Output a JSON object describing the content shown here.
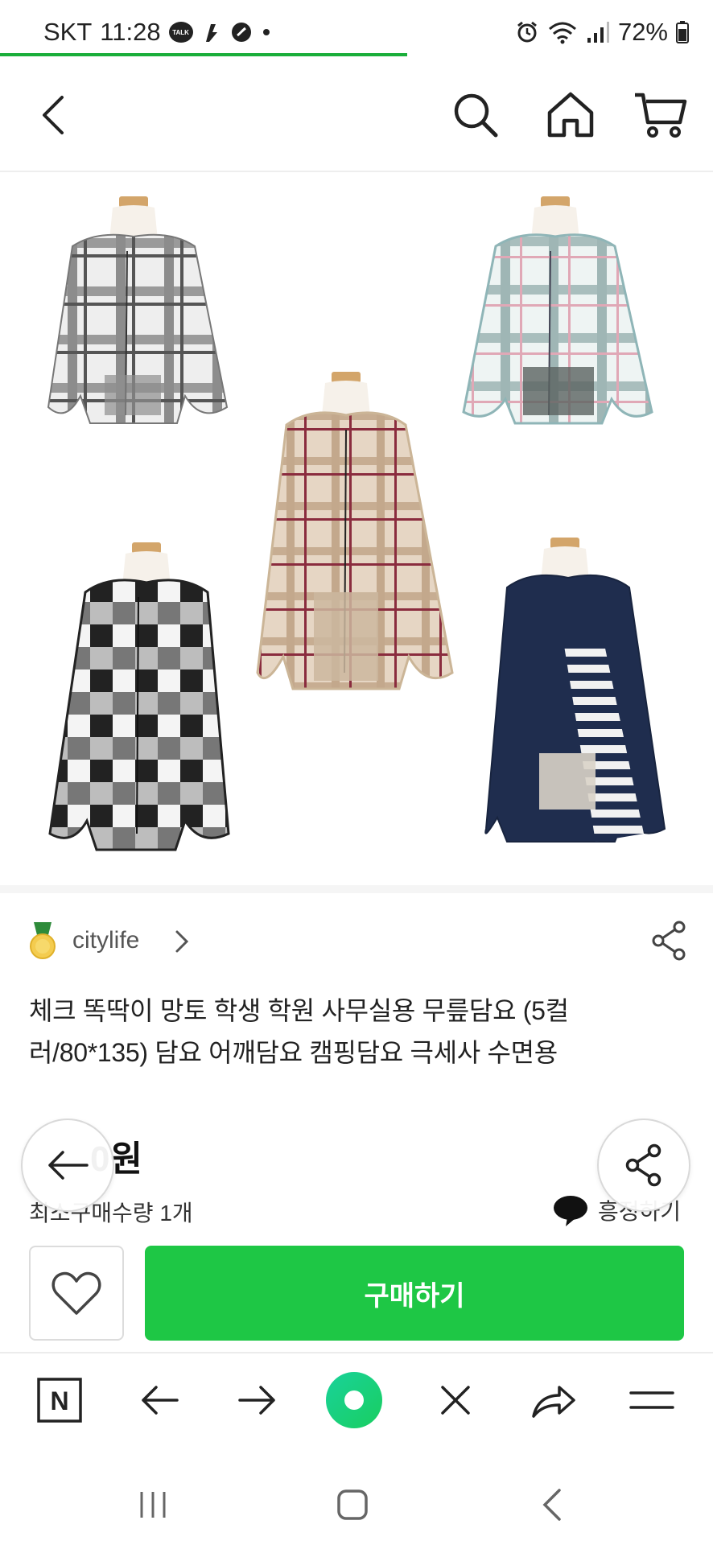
{
  "status_bar": {
    "carrier": "SKT",
    "time": "11:28",
    "talk_badge": "TALK",
    "battery": "72%"
  },
  "top_nav": {
    "back_icon": "chevron-left-icon",
    "search_icon": "search-icon",
    "home_icon": "home-icon",
    "cart_icon": "cart-icon"
  },
  "product": {
    "seller": "citylife",
    "title": "체크 똑딱이 망토 학생 학원 사무실용 무릎담요 (5컬러/80*135) 담요 어깨담요 캠핑담요 극세사 수면용",
    "price": "0원",
    "min_qty": "최소구매수량 1개",
    "talk_label": "흥정하기",
    "buy_label": "구매하기"
  },
  "colors": {
    "accent_green": "#1ec745",
    "loading_green": "#1aae3a",
    "naver_dot": "#19ce60"
  },
  "browser_bar": {
    "naver_logo": "N"
  }
}
